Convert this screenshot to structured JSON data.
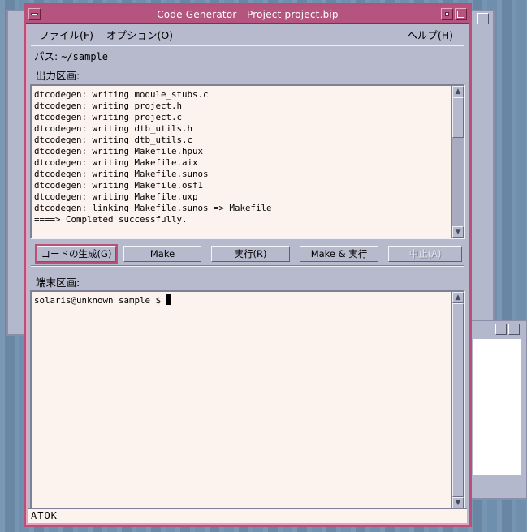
{
  "window": {
    "title": "Code Generator  - Project project.bip"
  },
  "menu": {
    "file": "ファイル(F)",
    "options": "オプション(O)",
    "help": "ヘルプ(H)"
  },
  "path": {
    "label": "パス:",
    "value": "~/sample"
  },
  "output": {
    "label": "出力区画:",
    "lines": [
      "dtcodegen: writing module_stubs.c",
      "dtcodegen: writing project.h",
      "dtcodegen: writing project.c",
      "dtcodegen: writing dtb_utils.h",
      "dtcodegen: writing dtb_utils.c",
      "dtcodegen: writing Makefile.hpux",
      "dtcodegen: writing Makefile.aix",
      "dtcodegen: writing Makefile.sunos",
      "dtcodegen: writing Makefile.osf1",
      "dtcodegen: writing Makefile.uxp",
      "dtcodegen: linking Makefile.sunos => Makefile",
      "====> Completed successfully."
    ]
  },
  "buttons": {
    "generate": "コードの生成(G)",
    "make": "Make",
    "run": "実行(R)",
    "make_run": "Make & 実行",
    "abort": "中止(A)"
  },
  "terminal": {
    "label": "端末区画:",
    "prompt": "solaris@unknown sample $ "
  },
  "status": {
    "input_method": "ATOK"
  },
  "colors": {
    "titlebar": "#b4547f",
    "window_bg": "#b7b9cd",
    "text_area_bg": "#fdf3ee"
  }
}
